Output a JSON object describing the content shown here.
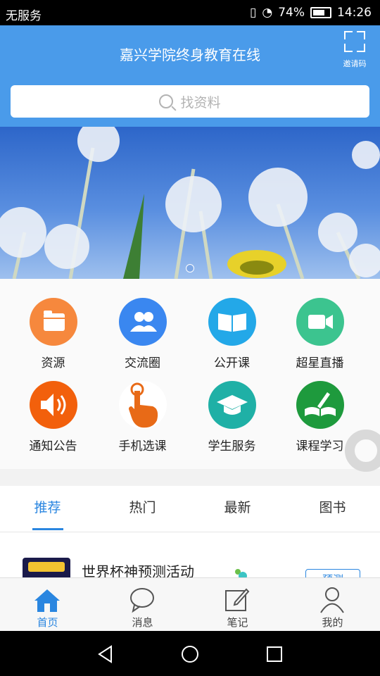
{
  "status_bar": {
    "carrier": "无服务",
    "battery": "74%",
    "time": "14:26"
  },
  "header": {
    "title": "嘉兴学院终身教育在线",
    "scan_label": "邀请码",
    "search_placeholder": "找资料"
  },
  "grid": {
    "items": [
      {
        "label": "资源",
        "icon": "folder-icon",
        "color": "#f6883d"
      },
      {
        "label": "交流圈",
        "icon": "people-icon",
        "color": "#3a87f0"
      },
      {
        "label": "公开课",
        "icon": "book-icon",
        "color": "#23a8e8"
      },
      {
        "label": "超星直播",
        "icon": "video-camera-icon",
        "color": "#3cc48f"
      },
      {
        "label": "通知公告",
        "icon": "speaker-icon",
        "color": "#f2600c"
      },
      {
        "label": "手机选课",
        "icon": "hand-tap-icon",
        "color": "#e86a17"
      },
      {
        "label": "学生服务",
        "icon": "graduation-cap-icon",
        "color": "#1fb0a6"
      },
      {
        "label": "课程学习",
        "icon": "open-book-pen-icon",
        "color": "#1e9a3d"
      }
    ]
  },
  "tabs": [
    {
      "label": "推荐",
      "active": true
    },
    {
      "label": "热门"
    },
    {
      "label": "最新"
    },
    {
      "label": "图书"
    }
  ],
  "list": {
    "first_item_title": "世界杯神预测活动",
    "first_item_thumb_text": "预测"
  },
  "bottom_nav": [
    {
      "label": "首页",
      "icon": "home-icon",
      "active": true
    },
    {
      "label": "消息",
      "icon": "chat-bubble-icon"
    },
    {
      "label": "笔记",
      "icon": "note-edit-icon"
    },
    {
      "label": "我的",
      "icon": "user-icon"
    }
  ]
}
